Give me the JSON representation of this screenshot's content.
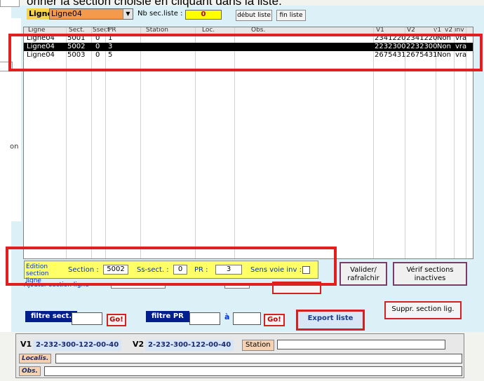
{
  "top_caption": "onner la section choisie en cliquant dans la liste.",
  "left_panel": {
    "label": "on"
  },
  "header": {
    "ligne_label": "Ligne:",
    "ligne_value": "Ligne04",
    "nb_label": "Nb sec.liste :",
    "nb_value": "0",
    "debut_button": "début liste",
    "fin_button": "fin liste"
  },
  "list": {
    "columns": [
      "Ligne",
      "Sect.",
      "Ssect",
      "PR",
      "Station",
      "Loc.",
      "Obs.",
      "V1",
      "V2",
      "v1",
      "v2",
      "inv"
    ],
    "rows": [
      [
        "Ligne04",
        "5001",
        "0",
        "1",
        "",
        "",
        "",
        "2341220",
        "2341220",
        "Non",
        "vra"
      ],
      [
        "Ligne04",
        "5002",
        "0",
        "3",
        "",
        "",
        "",
        "2232300",
        "2232300",
        "Non",
        "vra"
      ],
      [
        "Ligne04",
        "5003",
        "0",
        "5",
        "",
        "",
        "",
        "2675431",
        "2675431",
        "Non",
        "vra"
      ]
    ],
    "selected_row": 1
  },
  "edit": {
    "title": "Edition section ligne",
    "section_label": "Section :",
    "section_value": "5002",
    "ssect_label": "Ss-sect. :",
    "ssect_value": "0",
    "pr_label": "PR :",
    "pr_value": "3",
    "sens_label": "Sens voie inv :"
  },
  "add": {
    "label": "Ajouter section ligne"
  },
  "buttons": {
    "valider": "Valider/ rafraîchir",
    "verif": "Vérif sections inactives",
    "suppr": "Suppr. section lig.",
    "export": "Export liste"
  },
  "filters": {
    "sect_label": "filtre sect.",
    "pr_label": "filtre PR",
    "a_label": "à",
    "go": "Go!"
  },
  "info": {
    "v1_label": "V1",
    "v1_value": "2-232-300-122-00-40",
    "v2_label": "V2",
    "v2_value": "2-232-300-122-00-40",
    "station_label": "Station",
    "localis_label": "Localis.",
    "obs_label": "Obs."
  },
  "colors": {
    "form_bg": "#dbf1f7",
    "highlight": "#e02020",
    "nb_box": "#ffff00",
    "combo": "#f39a4d",
    "filter_label": "#001f8c"
  }
}
